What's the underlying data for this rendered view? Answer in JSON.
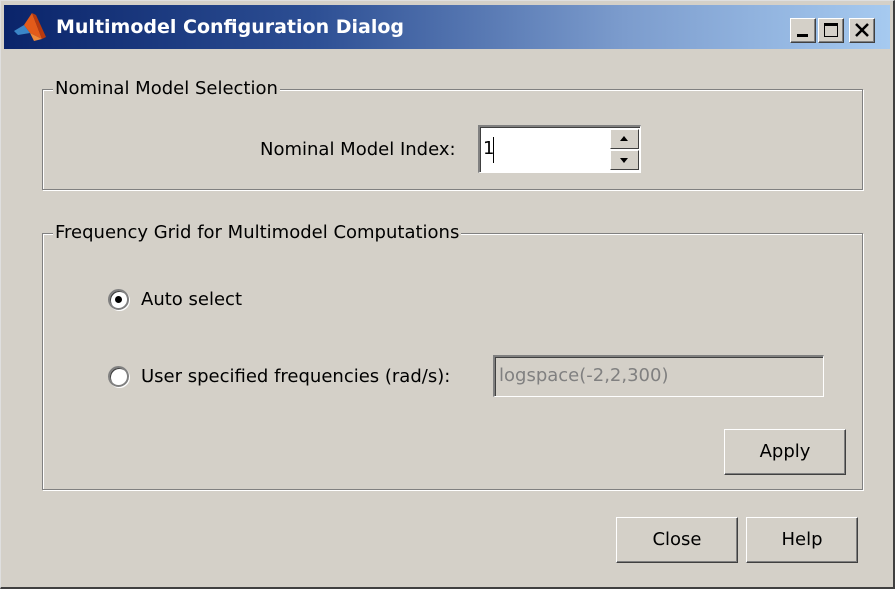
{
  "window": {
    "title": "Multimodel Configuration Dialog",
    "app_icon": "matlab-icon",
    "caption_buttons": [
      "minimize-icon",
      "maximize-icon",
      "close-icon"
    ]
  },
  "nominal_group": {
    "title": "Nominal Model Selection",
    "index_label": "Nominal Model Index:",
    "index_value": "1"
  },
  "frequency_group": {
    "title": "Frequency Grid for Multimodel Computations",
    "auto_label": "Auto select",
    "auto_selected": true,
    "user_label": "User specified frequencies (rad/s):",
    "user_selected": false,
    "user_field_value": "logspace(-2,2,300)",
    "apply_label": "Apply"
  },
  "footer": {
    "close_label": "Close",
    "help_label": "Help"
  }
}
